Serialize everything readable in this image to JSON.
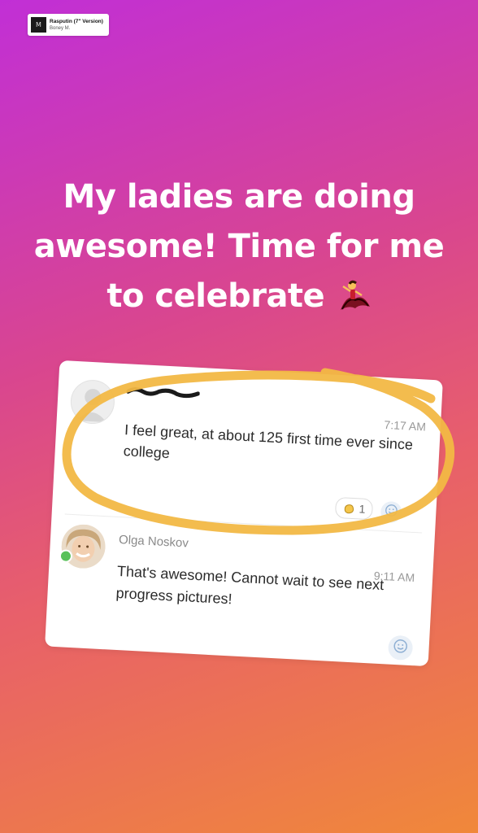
{
  "music_sticker": {
    "song_title": "Rasputin (7\" Version)",
    "artist": "Boney M.",
    "album_art_glyph": "M"
  },
  "caption": {
    "line1": "My ladies are doing",
    "line2": "awesome! Time for me",
    "line3": "to celebrate",
    "emoji": "dancer-emoji"
  },
  "chat_card": {
    "message1": {
      "sender_name": "",
      "time": "7:17 AM",
      "text": "I feel great, at about 125 first time ever since college",
      "reaction_count": "1"
    },
    "message2": {
      "sender_name": "Olga Noskov",
      "time": "9:11 AM",
      "text": "That's awesome! Cannot wait to see next progress pictures!"
    }
  },
  "colors": {
    "gradient_top": "#c12fd6",
    "gradient_bottom": "#f0883a",
    "highlight_ring": "#f2b844"
  }
}
